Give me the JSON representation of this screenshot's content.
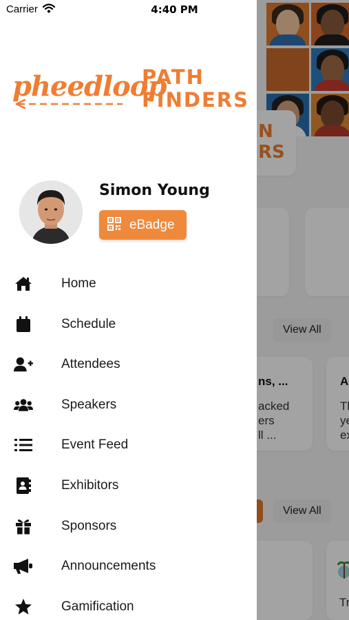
{
  "status_bar": {
    "carrier": "Carrier",
    "time": "4:40 PM"
  },
  "logo": {
    "brand": "pheedloop",
    "title_line1": "PATH",
    "title_line2": "FINDERS"
  },
  "profile": {
    "name": "Simon Young",
    "ebadge_label": "eBadge"
  },
  "menu": [
    {
      "label": "Home",
      "icon": "home-icon"
    },
    {
      "label": "Schedule",
      "icon": "calendar-icon"
    },
    {
      "label": "Attendees",
      "icon": "user-plus-icon"
    },
    {
      "label": "Speakers",
      "icon": "users-icon"
    },
    {
      "label": "Event Feed",
      "icon": "list-icon"
    },
    {
      "label": "Exhibitors",
      "icon": "address-book-icon"
    },
    {
      "label": "Sponsors",
      "icon": "gift-icon"
    },
    {
      "label": "Announcements",
      "icon": "megaphone-icon"
    },
    {
      "label": "Gamification",
      "icon": "star-icon"
    }
  ],
  "background": {
    "banner_partial_line1": "N",
    "banner_partial_line2": "RS",
    "view_all_1": "View All",
    "view_all_2": "View All",
    "card1_title": "ns, ...",
    "card1_line1": "acked",
    "card1_line2": "ers",
    "card1_line3": "ll ...",
    "card2_title": "A",
    "card2_line1": "Th",
    "card2_line2": "ye",
    "card2_line3": "ex",
    "card3_partial": "Tr"
  },
  "colors": {
    "accent": "#ef8a3d",
    "brand_orange": "#ef7d32",
    "overlay": "rgba(0,0,0,0.36)"
  }
}
